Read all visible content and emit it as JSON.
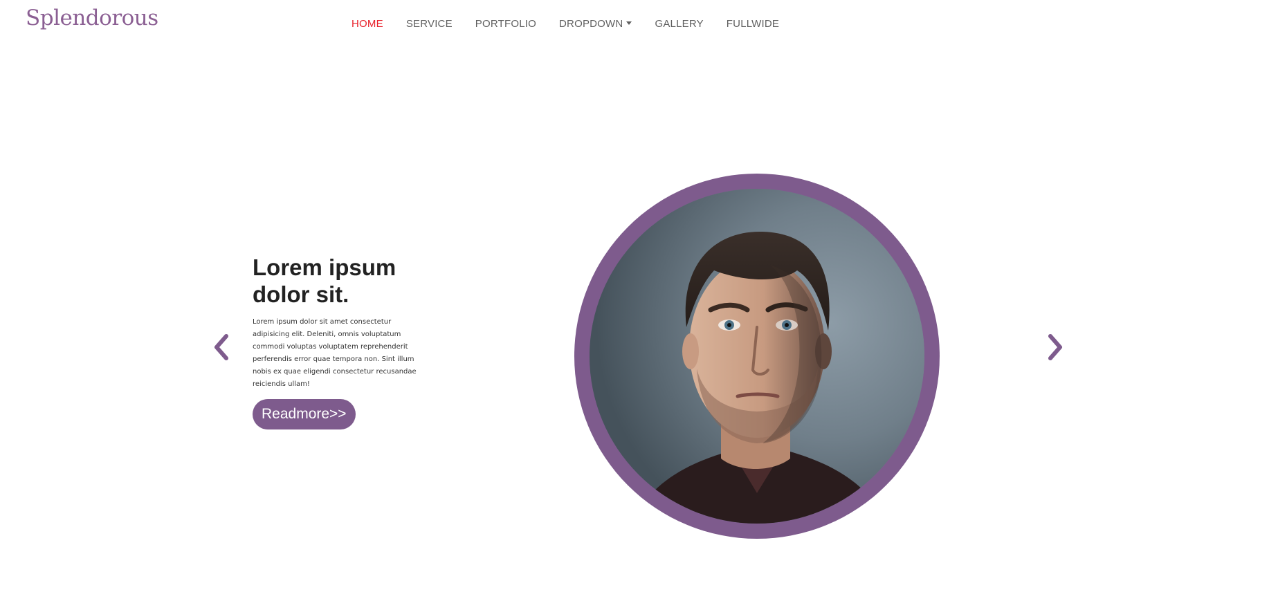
{
  "header": {
    "brand": "Splendorous",
    "nav": [
      {
        "label": "HOME",
        "active": true
      },
      {
        "label": "SERVICE",
        "active": false
      },
      {
        "label": "PORTFOLIO",
        "active": false
      },
      {
        "label": "DROPDOWN",
        "active": false,
        "has_caret": true
      },
      {
        "label": "GALLERY",
        "active": false
      },
      {
        "label": "FULLWIDE",
        "active": false
      }
    ]
  },
  "slide": {
    "title_line1": "Lorem ipsum",
    "title_line2": "dolor sit.",
    "body": "Lorem ipsum dolor sit amet consectetur adipisicing elit. Deleniti, omnis voluptatum commodi voluptas voluptatem reprehenderit perferendis error quae tempora non. Sint illum nobis ex quae eligendi consectetur recusandae reiciendis ullam!",
    "button_label": "Readmore>>",
    "portrait_alt": "portrait-photo"
  },
  "icons": {
    "prev": "chevron-left-icon",
    "next": "chevron-right-icon",
    "dropdown": "caret-down-icon"
  },
  "colors": {
    "brand": "#8b5f93",
    "accent": "#7e5b8d",
    "nav_active": "#e8202a",
    "nav_text": "#5f5f5f"
  }
}
